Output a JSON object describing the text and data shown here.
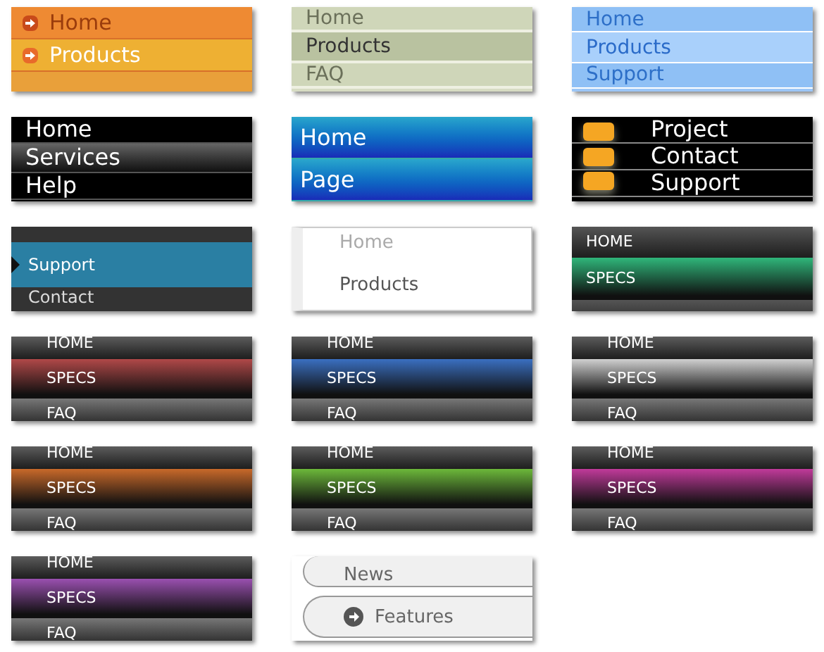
{
  "menus": [
    {
      "kind": "orange",
      "items": [
        {
          "label": "Home",
          "selected": false
        },
        {
          "label": "Products",
          "selected": true
        }
      ]
    },
    {
      "kind": "sage",
      "items": [
        {
          "label": "Home",
          "selected": false
        },
        {
          "label": "Products",
          "selected": true
        },
        {
          "label": "FAQ",
          "selected": false
        }
      ]
    },
    {
      "kind": "sky",
      "items": [
        {
          "label": "Home",
          "selected": false
        },
        {
          "label": "Products",
          "selected": true
        },
        {
          "label": "Support",
          "selected": false
        }
      ]
    },
    {
      "kind": "black",
      "items": [
        {
          "label": "Home",
          "selected": false
        },
        {
          "label": "Services",
          "selected": true
        },
        {
          "label": "Help",
          "selected": false
        }
      ]
    },
    {
      "kind": "blue",
      "items": [
        {
          "label": "Home",
          "selected": false
        },
        {
          "label": "Page",
          "selected": false
        }
      ]
    },
    {
      "kind": "contact",
      "items": [
        {
          "label": "Project",
          "selected": false
        },
        {
          "label": "Contact",
          "selected": false
        },
        {
          "label": "Support",
          "selected": false
        }
      ]
    },
    {
      "kind": "teal",
      "items": [
        {
          "label": "Support",
          "selected": true
        },
        {
          "label": "Contact",
          "selected": false
        }
      ]
    },
    {
      "kind": "plain",
      "items": [
        {
          "label": "Home",
          "selected": false
        },
        {
          "label": "Products",
          "selected": true
        }
      ]
    },
    {
      "kind": "specs-left",
      "color": "#2fb67a",
      "items": [
        {
          "label": "HOME",
          "selected": false
        },
        {
          "label": "SPECS",
          "selected": true
        },
        {
          "selected": false
        }
      ]
    },
    {
      "kind": "specs",
      "color": "#b04848",
      "items": [
        {
          "label": "HOME",
          "selected": false
        },
        {
          "label": "SPECS",
          "selected": true
        },
        {
          "label": "FAQ",
          "selected": false
        }
      ]
    },
    {
      "kind": "specs",
      "color": "#3a6fc0",
      "items": [
        {
          "label": "HOME",
          "selected": false
        },
        {
          "label": "SPECS",
          "selected": true
        },
        {
          "label": "FAQ",
          "selected": false
        }
      ]
    },
    {
      "kind": "specs",
      "color": "#d0d0d0",
      "items": [
        {
          "label": "HOME",
          "selected": false
        },
        {
          "label": "SPECS",
          "selected": true
        },
        {
          "label": "FAQ",
          "selected": false
        }
      ]
    },
    {
      "kind": "specs",
      "color": "#c8692a",
      "items": [
        {
          "label": "HOME",
          "selected": false
        },
        {
          "label": "SPECS",
          "selected": true
        },
        {
          "label": "FAQ",
          "selected": false
        }
      ]
    },
    {
      "kind": "specs",
      "color": "#6cb83a",
      "items": [
        {
          "label": "HOME",
          "selected": false
        },
        {
          "label": "SPECS",
          "selected": true
        },
        {
          "label": "FAQ",
          "selected": false
        }
      ]
    },
    {
      "kind": "specs",
      "color": "#c03a9a",
      "items": [
        {
          "label": "HOME",
          "selected": false
        },
        {
          "label": "SPECS",
          "selected": true
        },
        {
          "label": "FAQ",
          "selected": false
        }
      ]
    },
    {
      "kind": "specs",
      "color": "#9a50b0",
      "items": [
        {
          "label": "HOME",
          "selected": false
        },
        {
          "label": "SPECS",
          "selected": true
        },
        {
          "label": "FAQ",
          "selected": false
        }
      ]
    },
    {
      "kind": "rounded",
      "items": [
        {
          "label": "News",
          "selected": false
        },
        {
          "label": "Features",
          "selected": true
        }
      ]
    }
  ]
}
